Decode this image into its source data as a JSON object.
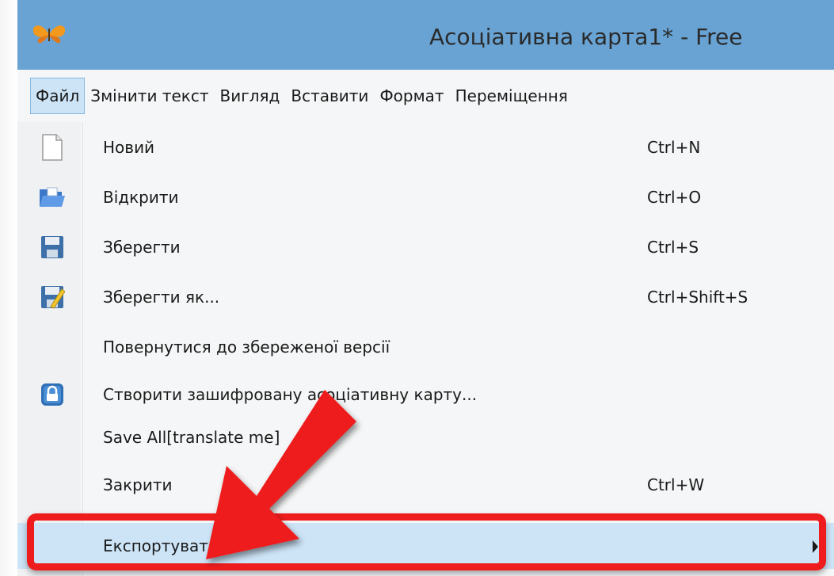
{
  "window": {
    "title": "Асоціативна карта1* - Free",
    "icon": "freemind-butterfly-icon"
  },
  "menubar": {
    "items": [
      {
        "label": "Файл",
        "active": true
      },
      {
        "label": "Змінити текст"
      },
      {
        "label": "Вигляд"
      },
      {
        "label": "Вставити"
      },
      {
        "label": "Формат"
      },
      {
        "label": "Переміщення"
      }
    ]
  },
  "file_menu": {
    "items": [
      {
        "label": "Новий",
        "shortcut": "Ctrl+N",
        "icon": "new-document-icon"
      },
      {
        "label": "Відкрити",
        "shortcut": "Ctrl+O",
        "icon": "open-folder-icon"
      },
      {
        "label": "Зберегти",
        "shortcut": "Ctrl+S",
        "icon": "save-disk-icon"
      },
      {
        "label": "Зберегти як...",
        "shortcut": "Ctrl+Shift+S",
        "icon": "save-as-icon"
      },
      {
        "label": "Повернутися до збереженої версії",
        "shortcut": ""
      },
      {
        "label": "Створити зашифровану асоціативну карту...",
        "shortcut": "",
        "icon": "lock-icon"
      },
      {
        "label": "Save All[translate me]",
        "shortcut": ""
      },
      {
        "label": "Закрити",
        "shortcut": "Ctrl+W"
      },
      {
        "label": "Експортувати",
        "shortcut": "",
        "submenu": true,
        "highlighted": true
      }
    ]
  },
  "annotation": {
    "color": "#ee1c1c"
  }
}
